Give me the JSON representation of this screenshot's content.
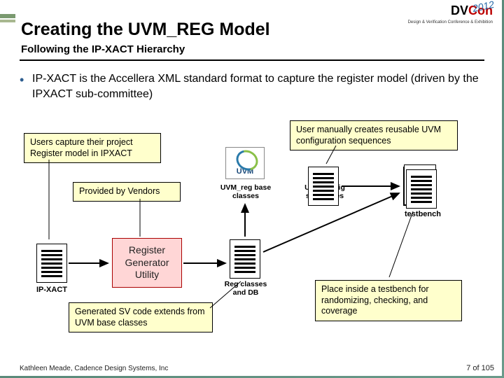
{
  "header": {
    "title": "Creating the UVM_REG Model",
    "subtitle": "Following the IP-XACT Hierarchy",
    "logo_text": "DVCon",
    "logo_sub": "Design & Verification Conference & Exhibition",
    "year": "2012"
  },
  "bullet": "IP-XACT is the Accellera XML standard format to capture the register model (driven by the IPXACT sub-committee)",
  "boxes": {
    "users_capture": "Users capture their project Register model in IPXACT",
    "provided_vendors": "Provided by Vendors",
    "user_manual": "User manually creates reusable UVM configuration sequences",
    "gen_sv": "Generated SV code extends from UVM base classes",
    "place_tb": "Place inside a testbench for randomizing, checking, and coverage",
    "reg_gen": "Register Generator Utility"
  },
  "labels": {
    "ipxact": "IP-XACT",
    "uvm_reg": "UVM_reg base classes",
    "reg_classes": "Reg classes and DB",
    "uvm_cfg": "UVM config sequences",
    "testbench": "testbench",
    "uvm": "UVM"
  },
  "footer": {
    "left": "Kathleen Meade, Cadence Design Systems, Inc",
    "right": "7 of 105"
  }
}
